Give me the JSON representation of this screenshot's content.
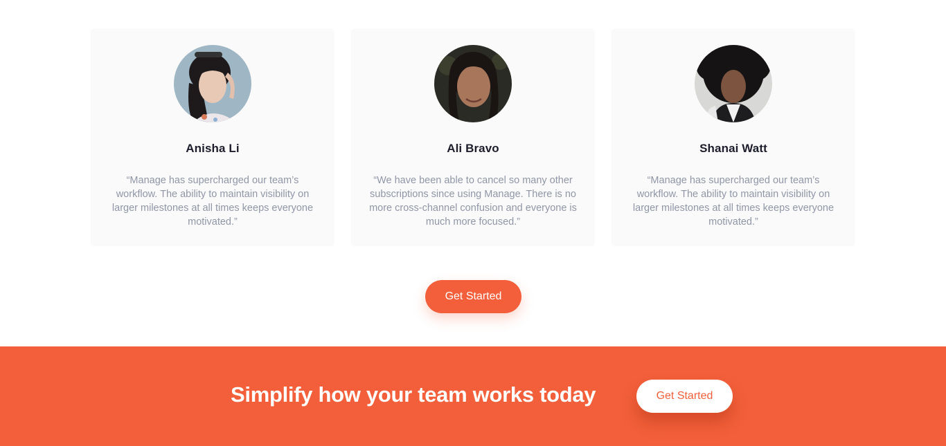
{
  "testimonials": [
    {
      "name": "Anisha Li",
      "quote": "“Manage has supercharged our team’s workflow. The ability to maintain visibility on larger milestones at all times keeps everyone motivated.”"
    },
    {
      "name": "Ali Bravo",
      "quote": "“We have been able to cancel so many other subscriptions since using Manage. There is no more cross-channel confusion and everyone is much more focused.”"
    },
    {
      "name": "Shanai Watt",
      "quote": "“Manage has supercharged our team’s workflow. The ability to maintain visibility on larger milestones at all times keeps everyone motivated.”"
    }
  ],
  "cta": {
    "label": "Get Started"
  },
  "banner": {
    "title": "Simplify how your team works today",
    "button_label": "Get Started"
  },
  "colors": {
    "accent": "#f25f3a",
    "card_bg": "#fafafa",
    "heading": "#1d1d2c",
    "body_text": "#9096a6"
  }
}
